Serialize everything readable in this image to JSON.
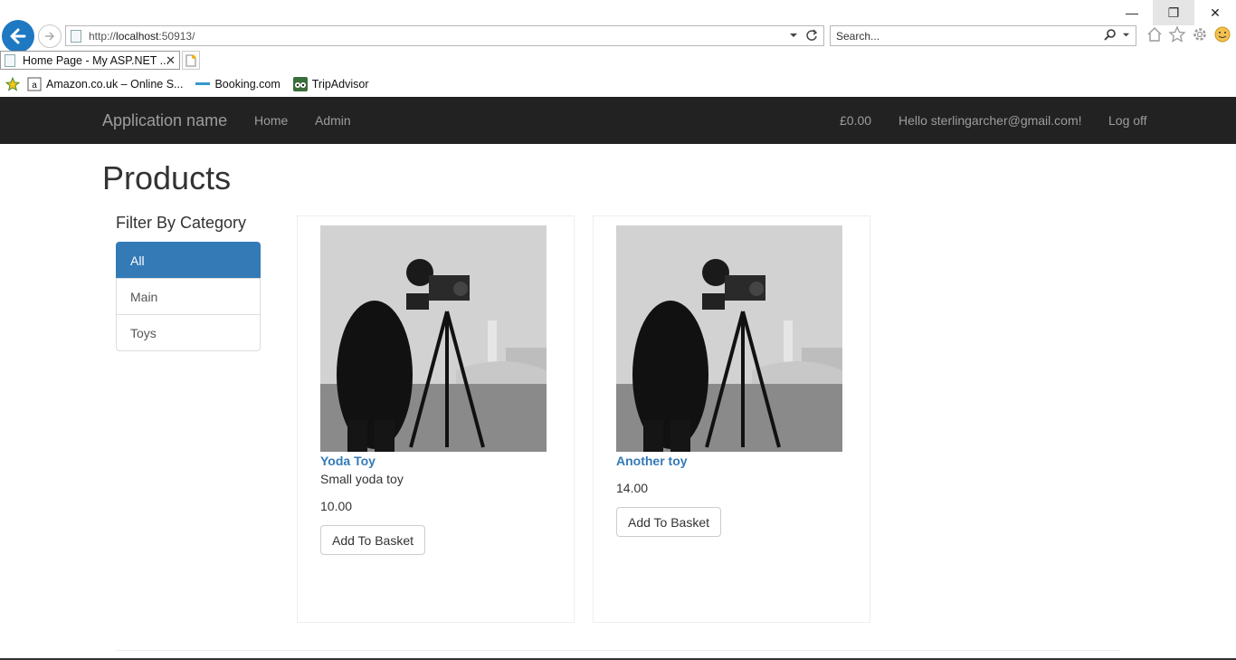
{
  "browser": {
    "url_prefix": "http://",
    "url_host": "localhost",
    "url_rest": ":50913/",
    "search_placeholder": "Search...",
    "tab_title": "Home Page - My ASP.NET ...",
    "favorites": [
      {
        "label": "Amazon.co.uk – Online S..."
      },
      {
        "label": "Booking.com"
      },
      {
        "label": "TripAdvisor"
      }
    ],
    "window_controls": {
      "minimize": "—",
      "restore": "❐",
      "close": "✕"
    }
  },
  "navbar": {
    "brand": "Application name",
    "links": [
      "Home",
      "Admin"
    ],
    "basket": "£0.00",
    "greeting": "Hello sterlingarcher@gmail.com!",
    "logoff": "Log off"
  },
  "page": {
    "title": "Products",
    "filter_title": "Filter By Category",
    "categories": [
      {
        "label": "All",
        "active": true
      },
      {
        "label": "Main",
        "active": false
      },
      {
        "label": "Toys",
        "active": false
      }
    ]
  },
  "products": [
    {
      "name": "Yoda Toy",
      "description": "Small yoda toy",
      "price": "10.00",
      "button": "Add To Basket"
    },
    {
      "name": "Another toy",
      "description": "",
      "price": "14.00",
      "button": "Add To Basket"
    }
  ],
  "colors": {
    "navbar": "#222222",
    "primary": "#337ab7",
    "browser_back": "#1e78c2"
  }
}
